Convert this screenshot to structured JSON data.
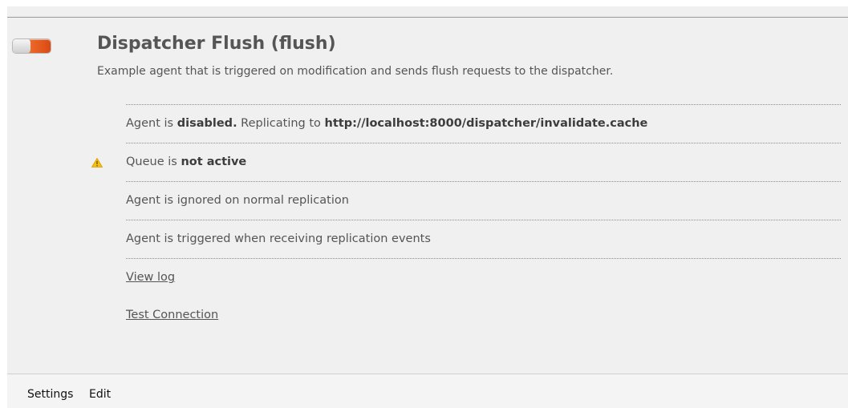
{
  "agent": {
    "title": "Dispatcher Flush (flush)",
    "description": "Example agent that is triggered on modification and sends flush requests to the dispatcher.",
    "toggle_state": "disabled",
    "toggle_colors": {
      "off": "#c6c6c6",
      "on": "#e0561a"
    }
  },
  "status": {
    "line1": {
      "prefix": "Agent is ",
      "state": "disabled.",
      "middle": " Replicating to ",
      "url": "http://localhost:8000/dispatcher/invalidate.cache"
    },
    "line2": {
      "prefix": "Queue is ",
      "state": "not active",
      "icon": "warning-icon",
      "icon_color": "#f2b705"
    },
    "line3": "Agent is ignored on normal replication",
    "line4": "Agent is triggered when receiving replication events",
    "view_log": "View log",
    "test_connection": "Test Connection"
  },
  "bottom_bar": {
    "settings": "Settings",
    "edit": "Edit"
  }
}
